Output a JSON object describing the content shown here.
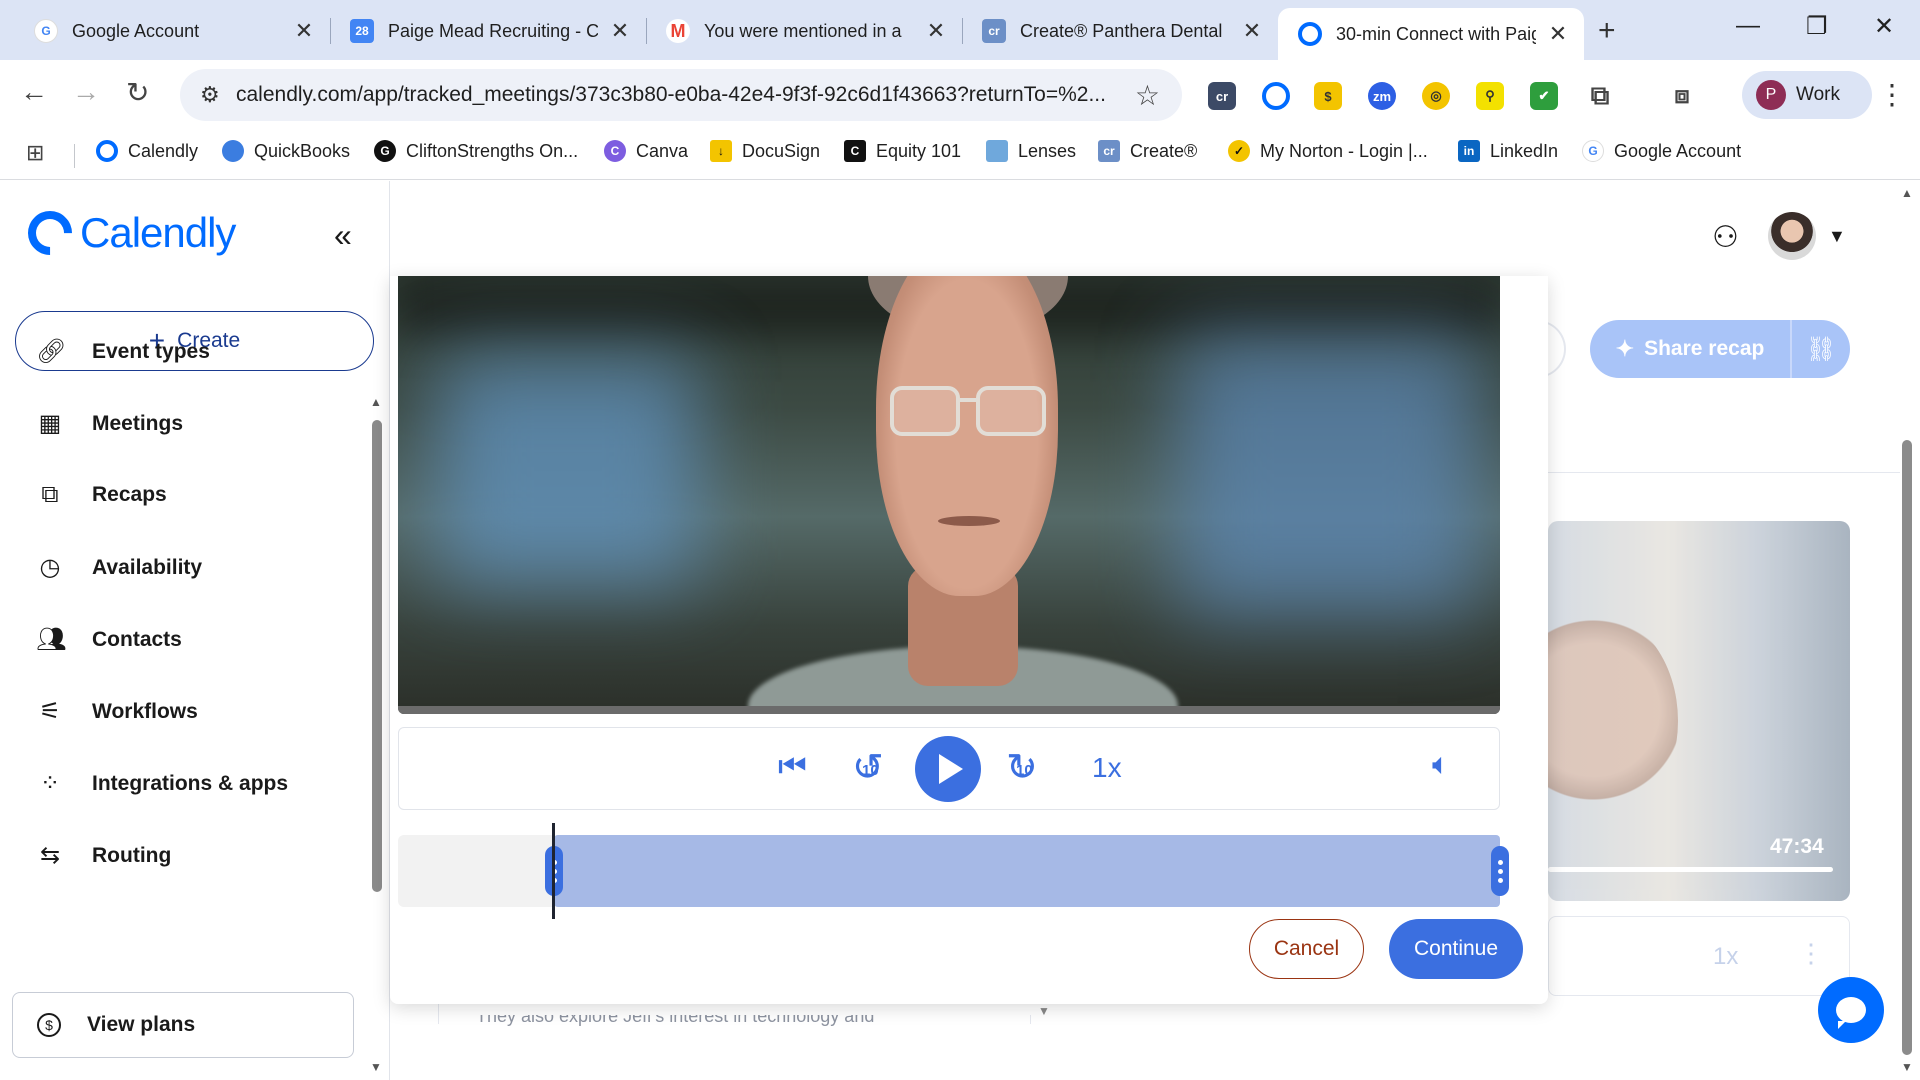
{
  "browser": {
    "tabs": [
      {
        "title": "Google Account",
        "icon": "google-icon"
      },
      {
        "title": "Paige Mead Recruiting - C",
        "icon": "calendar-icon"
      },
      {
        "title": "You were mentioned in a ",
        "icon": "gmail-icon"
      },
      {
        "title": "Create® Panthera Dental",
        "icon": "create-icon"
      },
      {
        "title": "30-min Connect with Paig",
        "icon": "calendly-icon",
        "active": true
      }
    ],
    "url": "calendly.com/app/tracked_meetings/373c3b80-e0ba-42e4-9f3f-92c6d1f43663?returnTo=%2...",
    "profile_initial": "P",
    "profile_label": "Work",
    "bookmarks": [
      {
        "label": "Calendly"
      },
      {
        "label": "QuickBooks"
      },
      {
        "label": "CliftonStrengths On..."
      },
      {
        "label": "Canva"
      },
      {
        "label": "DocuSign"
      },
      {
        "label": "Equity 101"
      },
      {
        "label": "Lenses"
      },
      {
        "label": "Create®"
      },
      {
        "label": "My Norton - Login |..."
      },
      {
        "label": "LinkedIn"
      },
      {
        "label": "Google Account"
      }
    ]
  },
  "sidebar": {
    "logo_text": "Calendly",
    "create_label": "Create",
    "items": [
      {
        "label": "Event types",
        "icon": "link-icon"
      },
      {
        "label": "Meetings",
        "icon": "calendar-icon"
      },
      {
        "label": "Recaps",
        "icon": "recaps-icon"
      },
      {
        "label": "Availability",
        "icon": "clock-icon"
      },
      {
        "label": "Contacts",
        "icon": "contacts-icon"
      },
      {
        "label": "Workflows",
        "icon": "workflows-icon"
      },
      {
        "label": "Integrations & apps",
        "icon": "grid-icon"
      },
      {
        "label": "Routing",
        "icon": "routing-icon"
      }
    ],
    "view_plans_label": "View plans"
  },
  "background": {
    "share_recap_label": "Share recap",
    "duration": "47:34",
    "speed": "1x",
    "summary_snippet": "They also explore Jeff's interest in technology and"
  },
  "modal": {
    "player": {
      "skip_back_seconds": "10",
      "skip_forward_seconds": "10",
      "speed": "1x"
    },
    "cancel_label": "Cancel",
    "continue_label": "Continue"
  },
  "colors": {
    "accent": "#3b6fe0",
    "brand": "#006bff",
    "trim_range": "#a6b9e6",
    "cancel": "#9a3412"
  }
}
